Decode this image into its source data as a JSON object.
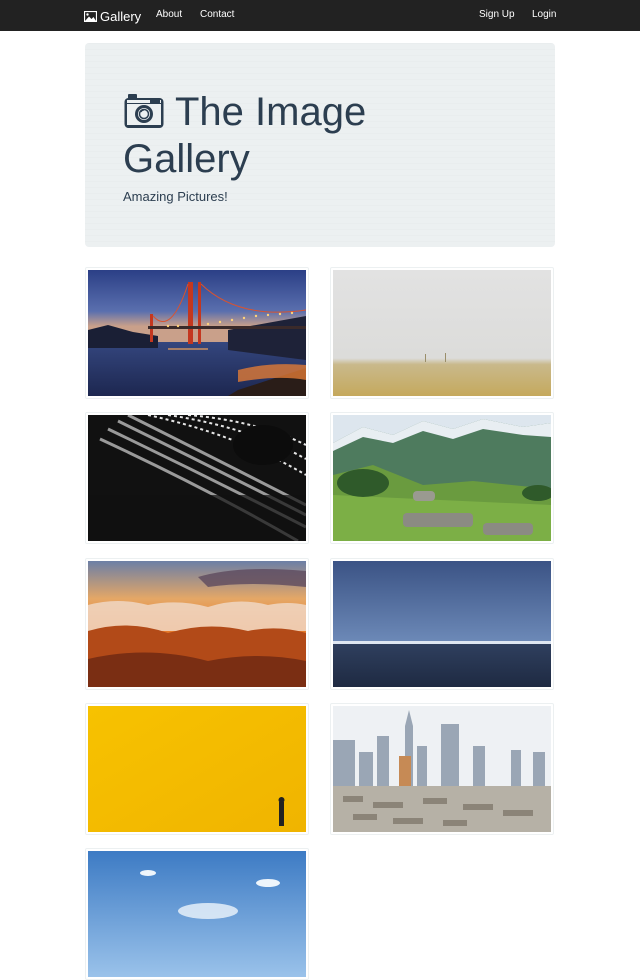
{
  "navbar": {
    "brand": "Gallery",
    "brand_icon": "image-icon",
    "links": [
      "About",
      "Contact"
    ],
    "right_links": [
      "Sign Up",
      "Login"
    ]
  },
  "jumbotron": {
    "icon": "camera-icon",
    "title": "The Image Gallery",
    "subtitle": "Amazing Pictures!"
  },
  "gallery": {
    "images": [
      "golden-gate-bridge-at-dusk",
      "foggy-field",
      "abstract-curved-architecture",
      "mountain-meadow-with-rocks",
      "sunset-over-clouds",
      "ocean-horizon",
      "yellow-wall-with-person",
      "city-skyline",
      "blue-sky"
    ]
  },
  "colors": {
    "navbar": "#222222",
    "jumbotron": "#ecf0f1",
    "text": "#2c3e50"
  }
}
